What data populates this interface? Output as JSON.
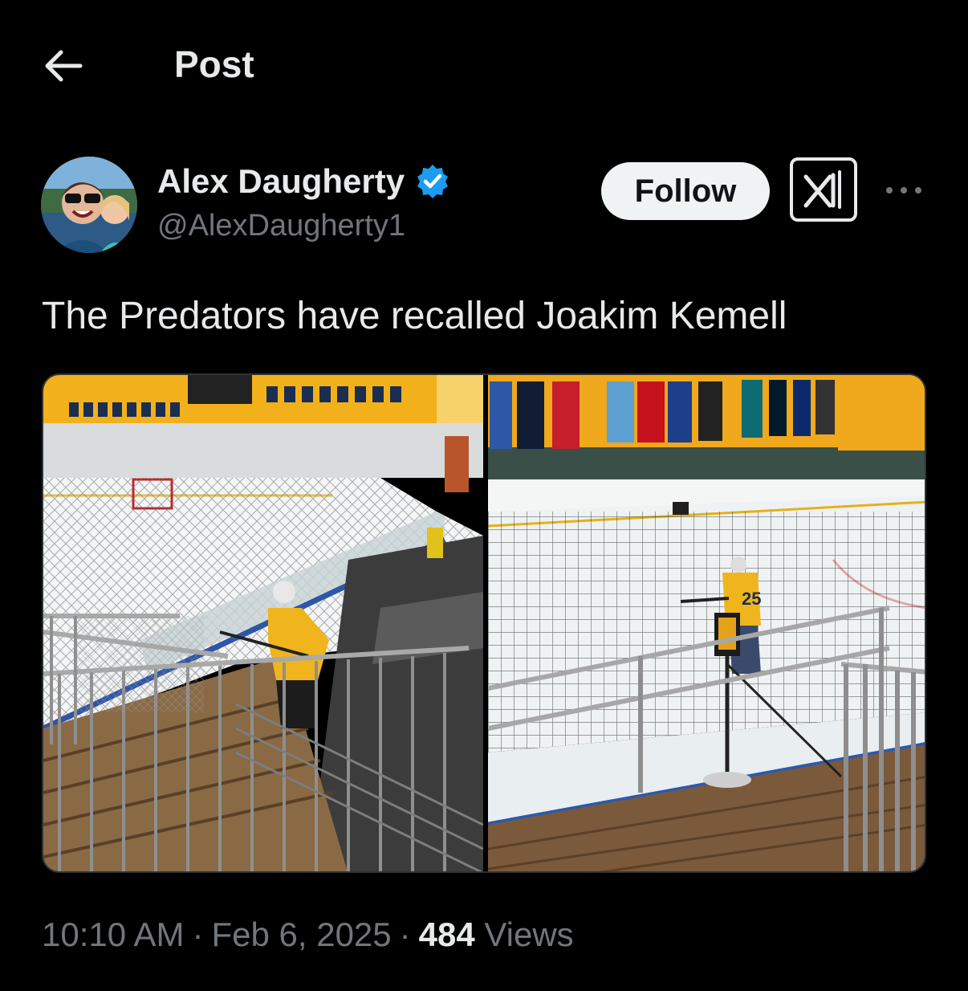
{
  "header": {
    "title": "Post",
    "back_icon": "arrow-left-icon"
  },
  "author": {
    "display_name": "Alex Daugherty",
    "handle": "@AlexDaugherty1",
    "verified": true,
    "verified_color": "#1d9bf0"
  },
  "actions": {
    "follow_label": "Follow",
    "grok_icon": "grok-icon",
    "more_icon": "more-icon"
  },
  "post": {
    "text": "The Predators have recalled Joakim Kemell",
    "media": [
      {
        "type": "photo",
        "alt_icon": "photo-rink-stairs"
      },
      {
        "type": "photo",
        "alt_icon": "photo-rink-net"
      }
    ]
  },
  "meta": {
    "time": "10:10 AM",
    "date": "Feb 6, 2025",
    "views_count": "484",
    "views_label": "Views",
    "separator": "·"
  },
  "colors": {
    "background": "#000000",
    "text": "#e7e9ea",
    "secondary": "#71767b",
    "accent_gold": "#f4b400"
  }
}
